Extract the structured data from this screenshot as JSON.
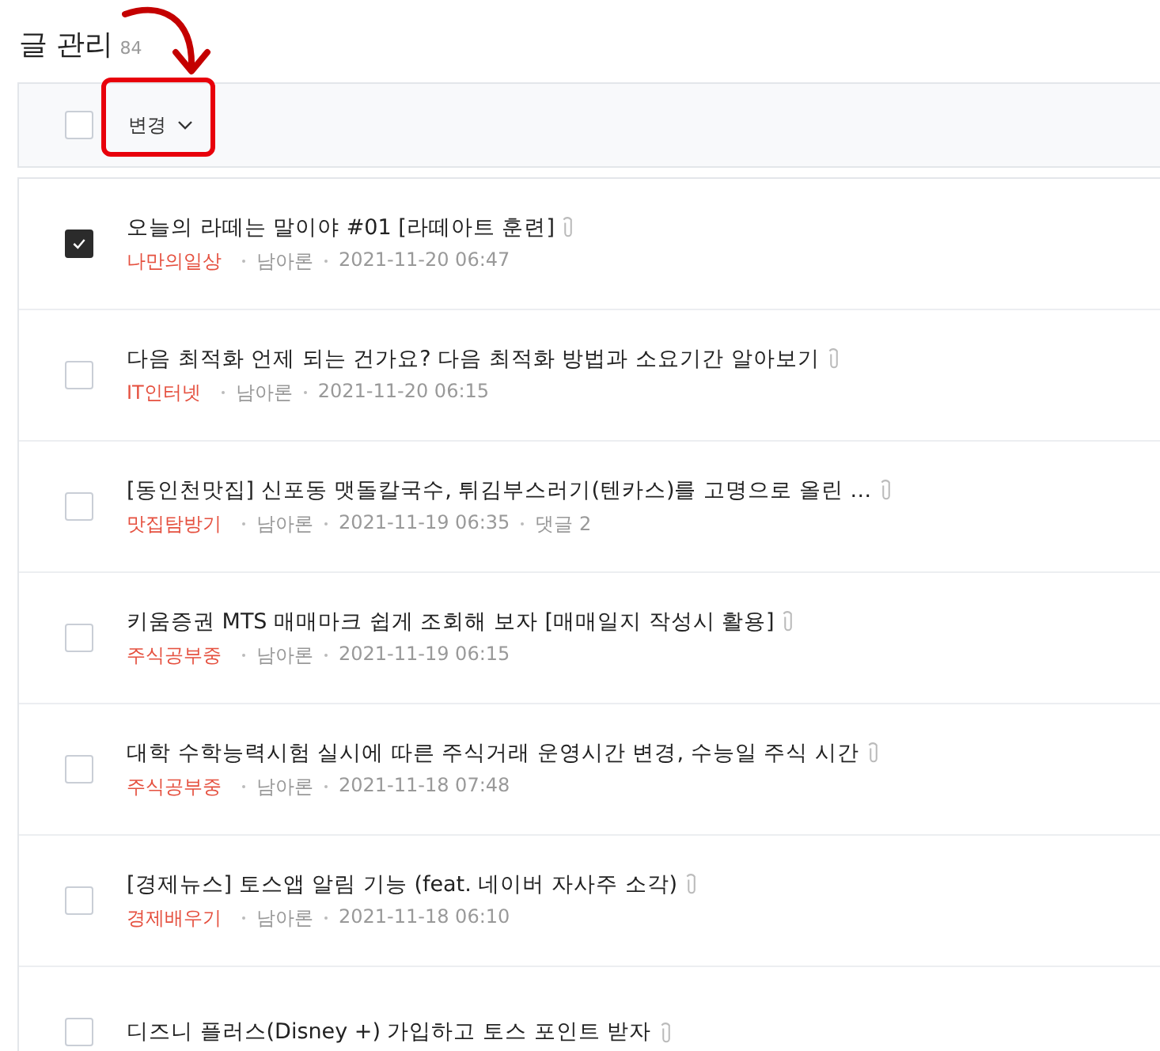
{
  "page": {
    "title": "글 관리",
    "count": "84"
  },
  "toolbar": {
    "select_all_checked": false,
    "action": "변경",
    "annotation": true
  },
  "posts": [
    {
      "checked": true,
      "title": "오늘의 라떼는 말이야 #01 [라떼아트 훈련]",
      "attachment": true,
      "category": "나만의일상",
      "author": "남아론",
      "date": "2021-11-20 06:47"
    },
    {
      "checked": false,
      "title": "다음 최적화 언제 되는 건가요? 다음 최적화 방법과 소요기간 알아보기",
      "attachment": true,
      "category": "IT인터넷",
      "author": "남아론",
      "date": "2021-11-20 06:15"
    },
    {
      "checked": false,
      "title": "[동인천맛집] 신포동 맷돌칼국수, 튀김부스러기(텐카스)를 고명으로 올린 …",
      "attachment": true,
      "category": "맛집탐방기",
      "author": "남아론",
      "date": "2021-11-19 06:35",
      "comments": "댓글 2"
    },
    {
      "checked": false,
      "title": "키움증권 MTS 매매마크 쉽게 조회해 보자 [매매일지 작성시 활용]",
      "attachment": true,
      "category": "주식공부중",
      "author": "남아론",
      "date": "2021-11-19 06:15"
    },
    {
      "checked": false,
      "title": "대학 수학능력시험 실시에 따른 주식거래 운영시간 변경, 수능일 주식 시간",
      "attachment": true,
      "category": "주식공부중",
      "author": "남아론",
      "date": "2021-11-18 07:48"
    },
    {
      "checked": false,
      "title": "[경제뉴스] 토스앱 알림 기능 (feat. 네이버 자사주 소각)",
      "attachment": true,
      "category": "경제배우기",
      "author": "남아론",
      "date": "2021-11-18 06:10"
    },
    {
      "checked": false,
      "title": "디즈니 플러스(Disney +) 가입하고 토스 포인트 받자",
      "attachment": true
    }
  ]
}
